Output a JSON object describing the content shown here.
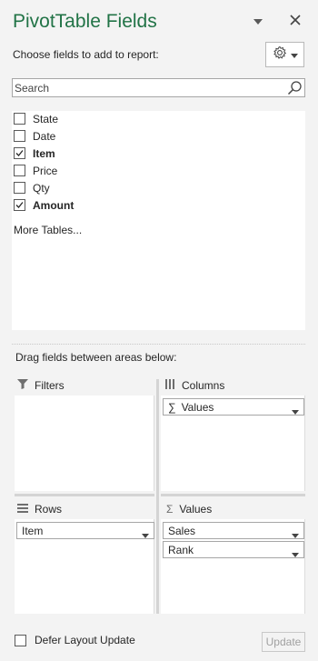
{
  "panel": {
    "title": "PivotTable Fields",
    "choose_label": "Choose fields to add to report:"
  },
  "search": {
    "placeholder": "Search"
  },
  "fields": [
    {
      "label": "State",
      "checked": false
    },
    {
      "label": "Date",
      "checked": false
    },
    {
      "label": "Item",
      "checked": true
    },
    {
      "label": "Price",
      "checked": false
    },
    {
      "label": "Qty",
      "checked": false
    },
    {
      "label": "Amount",
      "checked": true
    }
  ],
  "more_tables": "More Tables...",
  "drag_label": "Drag fields between areas below:",
  "areas": {
    "filters": {
      "label": "Filters",
      "items": []
    },
    "columns": {
      "label": "Columns",
      "items": [
        "Values"
      ]
    },
    "rows": {
      "label": "Rows",
      "items": [
        "Item"
      ]
    },
    "values": {
      "label": "Values",
      "items": [
        "Sales",
        "Rank"
      ]
    }
  },
  "footer": {
    "defer_label": "Defer Layout Update",
    "defer_checked": false,
    "update_label": "Update"
  },
  "colors": {
    "title": "#217346",
    "panel_bg": "#f3f3f3"
  }
}
